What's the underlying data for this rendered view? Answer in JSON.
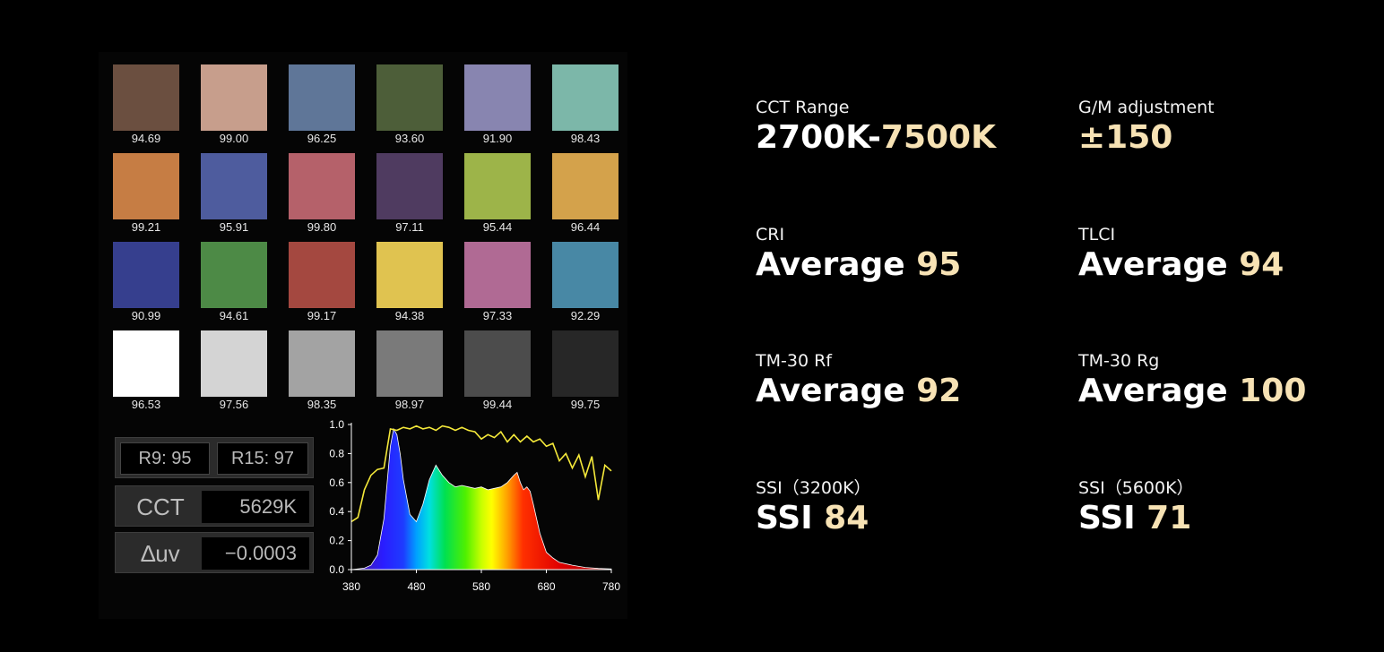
{
  "swatches": [
    {
      "color": "#6b4f40",
      "value": "94.69"
    },
    {
      "color": "#c79e8c",
      "value": "99.00"
    },
    {
      "color": "#5f7698",
      "value": "96.25"
    },
    {
      "color": "#4d5e39",
      "value": "93.60"
    },
    {
      "color": "#8885b0",
      "value": "91.90"
    },
    {
      "color": "#7cb7a9",
      "value": "98.43"
    },
    {
      "color": "#c67d44",
      "value": "99.21"
    },
    {
      "color": "#4e5c9e",
      "value": "95.91"
    },
    {
      "color": "#b5616a",
      "value": "99.80"
    },
    {
      "color": "#4f3b60",
      "value": "97.11"
    },
    {
      "color": "#9db449",
      "value": "95.44"
    },
    {
      "color": "#d4a24b",
      "value": "96.44"
    },
    {
      "color": "#363f8e",
      "value": "90.99"
    },
    {
      "color": "#4d8a46",
      "value": "94.61"
    },
    {
      "color": "#a44840",
      "value": "99.17"
    },
    {
      "color": "#e0c350",
      "value": "94.38"
    },
    {
      "color": "#b06a94",
      "value": "97.33"
    },
    {
      "color": "#4888a5",
      "value": "92.29"
    },
    {
      "color": "#ffffff",
      "value": "96.53"
    },
    {
      "color": "#d4d4d4",
      "value": "97.56"
    },
    {
      "color": "#a3a3a3",
      "value": "98.35"
    },
    {
      "color": "#7a7a7a",
      "value": "98.97"
    },
    {
      "color": "#4c4c4c",
      "value": "99.44"
    },
    {
      "color": "#272727",
      "value": "99.75"
    }
  ],
  "readouts": {
    "r9": "R9: 95",
    "r15": "R15: 97",
    "cct_label": "CCT",
    "cct_value": "5629K",
    "duv_label": "∆uv",
    "duv_value": "−0.0003"
  },
  "chart_data": {
    "type": "line",
    "xlim": [
      380,
      780
    ],
    "ylim": [
      0,
      1.0
    ],
    "x_ticks": [
      "380",
      "480",
      "580",
      "680",
      "780"
    ],
    "y_ticks": [
      "0.0",
      "0.2",
      "0.4",
      "0.6",
      "0.8",
      "1.0"
    ],
    "series": [
      {
        "color": "#ffffff",
        "fill": "spectrum-gradient",
        "x": [
          380,
          400,
          410,
          420,
          430,
          440,
          445,
          450,
          455,
          460,
          470,
          480,
          490,
          500,
          510,
          520,
          530,
          540,
          550,
          560,
          570,
          580,
          590,
          600,
          610,
          620,
          630,
          635,
          640,
          645,
          650,
          655,
          660,
          670,
          680,
          690,
          700,
          720,
          740,
          760,
          780
        ],
        "y": [
          0.0,
          0.01,
          0.03,
          0.1,
          0.35,
          0.85,
          0.97,
          0.93,
          0.8,
          0.62,
          0.38,
          0.33,
          0.45,
          0.62,
          0.72,
          0.65,
          0.6,
          0.57,
          0.58,
          0.57,
          0.56,
          0.57,
          0.55,
          0.56,
          0.57,
          0.6,
          0.65,
          0.67,
          0.6,
          0.55,
          0.57,
          0.54,
          0.45,
          0.25,
          0.12,
          0.08,
          0.05,
          0.03,
          0.015,
          0.008,
          0.005
        ]
      },
      {
        "color": "#f5e93a",
        "x": [
          380,
          390,
          400,
          410,
          420,
          430,
          440,
          450,
          460,
          470,
          480,
          490,
          500,
          510,
          520,
          530,
          540,
          550,
          560,
          570,
          580,
          590,
          600,
          610,
          620,
          630,
          640,
          650,
          660,
          670,
          680,
          690,
          700,
          710,
          720,
          730,
          740,
          750,
          760,
          770,
          780
        ],
        "y": [
          0.33,
          0.36,
          0.55,
          0.65,
          0.69,
          0.7,
          0.97,
          0.96,
          0.98,
          0.97,
          0.99,
          0.97,
          0.98,
          0.96,
          0.99,
          0.98,
          0.96,
          0.98,
          0.96,
          0.95,
          0.9,
          0.93,
          0.91,
          0.95,
          0.88,
          0.93,
          0.88,
          0.92,
          0.88,
          0.9,
          0.85,
          0.87,
          0.75,
          0.8,
          0.7,
          0.79,
          0.64,
          0.78,
          0.48,
          0.72,
          0.68
        ]
      }
    ]
  },
  "specs": [
    {
      "label": "CCT Range",
      "value": "2700K-7500K",
      "value_prefix": "",
      "value_hl": "7500K",
      "value_main": "2700K-"
    },
    {
      "label": "G/M adjustment",
      "value_main": "",
      "value_hl": "±150"
    },
    {
      "label": "CRI",
      "value_main": "Average ",
      "value_hl": "95"
    },
    {
      "label": "TLCI",
      "value_main": "Average ",
      "value_hl": "94"
    },
    {
      "label": "TM-30 Rf",
      "value_main": "Average ",
      "value_hl": "92"
    },
    {
      "label": "TM-30 Rg",
      "value_main": "Average ",
      "value_hl": "100"
    },
    {
      "label": "SSI（3200K）",
      "value_main": "SSI ",
      "value_hl": "84"
    },
    {
      "label": "SSI（5600K）",
      "value_main": "SSI ",
      "value_hl": "71"
    }
  ],
  "colors": {
    "highlight": "#f7e2b4",
    "background": "#000000"
  }
}
